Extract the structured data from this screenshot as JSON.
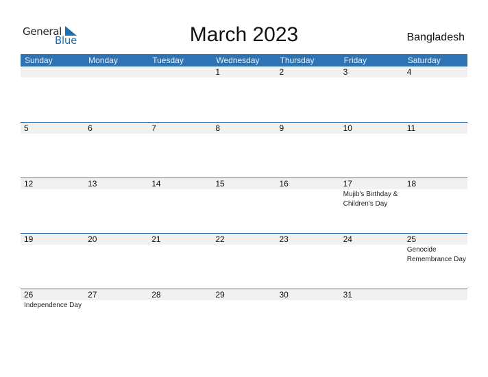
{
  "logo": {
    "line1": "General",
    "line2": "Blue"
  },
  "title": "March 2023",
  "country": "Bangladesh",
  "colors": {
    "accent": "#2e74b5",
    "band": "#f1f1f1"
  },
  "weekdays": [
    "Sunday",
    "Monday",
    "Tuesday",
    "Wednesday",
    "Thursday",
    "Friday",
    "Saturday"
  ],
  "weeks": [
    {
      "days": [
        {
          "num": "",
          "event": ""
        },
        {
          "num": "",
          "event": ""
        },
        {
          "num": "",
          "event": ""
        },
        {
          "num": "1",
          "event": ""
        },
        {
          "num": "2",
          "event": ""
        },
        {
          "num": "3",
          "event": ""
        },
        {
          "num": "4",
          "event": ""
        }
      ]
    },
    {
      "days": [
        {
          "num": "5",
          "event": ""
        },
        {
          "num": "6",
          "event": ""
        },
        {
          "num": "7",
          "event": ""
        },
        {
          "num": "8",
          "event": ""
        },
        {
          "num": "9",
          "event": ""
        },
        {
          "num": "10",
          "event": ""
        },
        {
          "num": "11",
          "event": ""
        }
      ]
    },
    {
      "days": [
        {
          "num": "12",
          "event": ""
        },
        {
          "num": "13",
          "event": ""
        },
        {
          "num": "14",
          "event": ""
        },
        {
          "num": "15",
          "event": ""
        },
        {
          "num": "16",
          "event": ""
        },
        {
          "num": "17",
          "event": "Mujib's Birthday & Children's Day"
        },
        {
          "num": "18",
          "event": ""
        }
      ]
    },
    {
      "days": [
        {
          "num": "19",
          "event": ""
        },
        {
          "num": "20",
          "event": ""
        },
        {
          "num": "21",
          "event": ""
        },
        {
          "num": "22",
          "event": ""
        },
        {
          "num": "23",
          "event": ""
        },
        {
          "num": "24",
          "event": ""
        },
        {
          "num": "25",
          "event": "Genocide Remembrance Day"
        }
      ]
    },
    {
      "days": [
        {
          "num": "26",
          "event": "Independence Day"
        },
        {
          "num": "27",
          "event": ""
        },
        {
          "num": "28",
          "event": ""
        },
        {
          "num": "29",
          "event": ""
        },
        {
          "num": "30",
          "event": ""
        },
        {
          "num": "31",
          "event": ""
        },
        {
          "num": "",
          "event": ""
        }
      ]
    }
  ]
}
